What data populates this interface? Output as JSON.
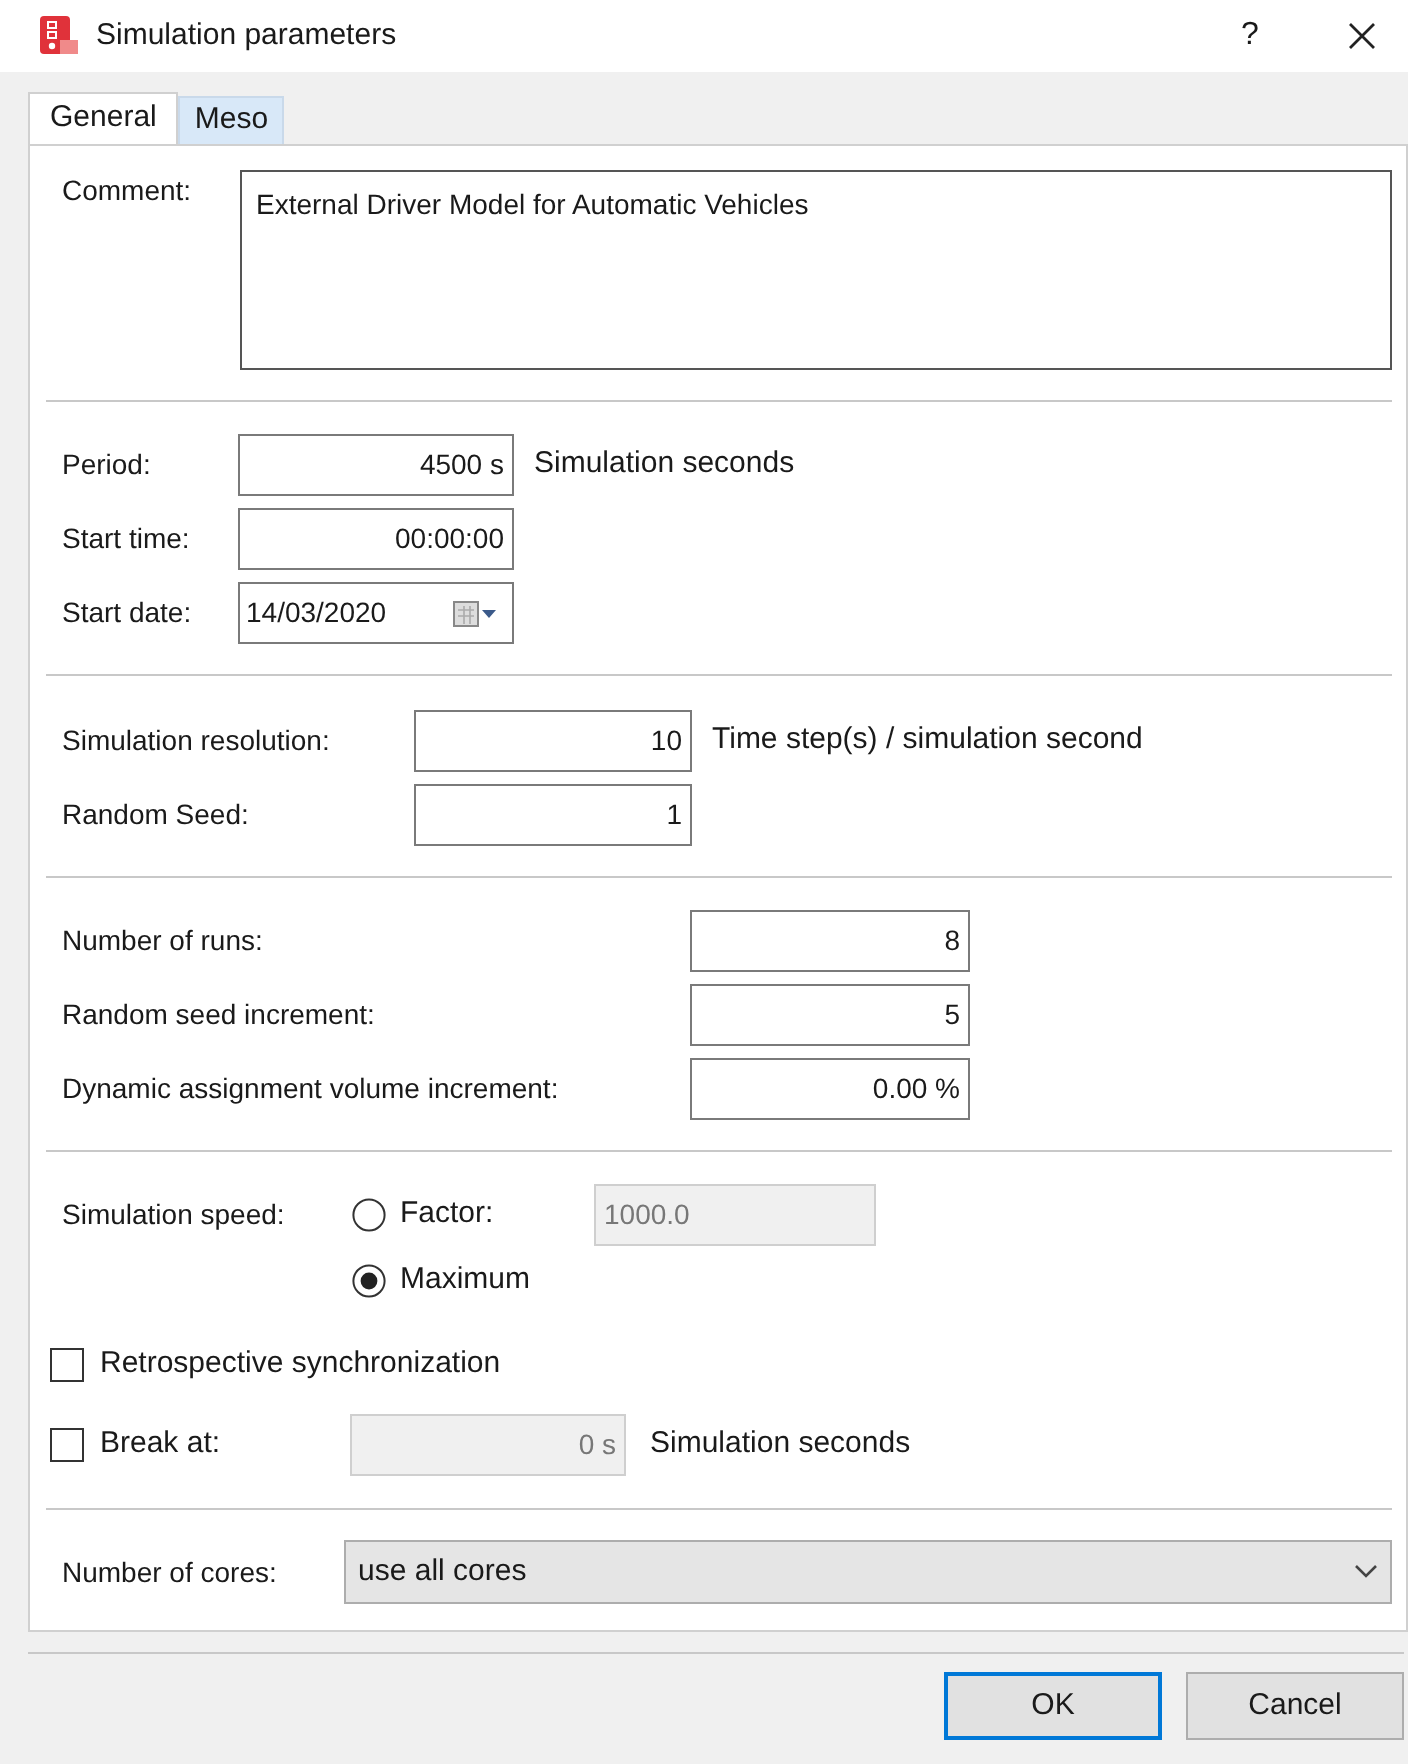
{
  "window": {
    "title": "Simulation parameters",
    "help": "?"
  },
  "tabs": [
    {
      "label": "General",
      "selected": true
    },
    {
      "label": "Meso",
      "selected": false
    }
  ],
  "comment": {
    "label": "Comment:",
    "value": "External Driver Model for Automatic Vehicles"
  },
  "time_section": [
    {
      "label": "Period:",
      "kind": "text",
      "value": "4500 s",
      "suffix": "Simulation seconds"
    },
    {
      "label": "Start time:",
      "kind": "text",
      "value": "00:00:00"
    },
    {
      "label": "Start date:",
      "kind": "date",
      "value": "14/03/2020"
    }
  ],
  "resolution_section": [
    {
      "label": "Simulation resolution:",
      "kind": "text",
      "value": "10",
      "suffix": "Time step(s) / simulation second"
    },
    {
      "label": "Random Seed:",
      "kind": "text",
      "value": "1"
    }
  ],
  "runs_section": [
    {
      "label": "Number of runs:",
      "kind": "text",
      "value": "8"
    },
    {
      "label": "Random seed increment:",
      "kind": "text",
      "value": "5"
    },
    {
      "label": "Dynamic assignment volume increment:",
      "kind": "text",
      "value": "0.00 %"
    }
  ],
  "speed": {
    "label": "Simulation speed:",
    "options": [
      {
        "label": "Factor:",
        "selected": false,
        "value": "1000.0",
        "disabled": true
      },
      {
        "label": "Maximum",
        "selected": true
      }
    ]
  },
  "checks": [
    {
      "label": "Retrospective synchronization",
      "checked": false
    },
    {
      "label": "Break at:",
      "checked": false,
      "value": "0 s",
      "disabled": true,
      "suffix": "Simulation seconds"
    }
  ],
  "cores": {
    "label": "Number of cores:",
    "value": "use all cores"
  },
  "buttons": [
    {
      "label": "OK",
      "kind": "default"
    },
    {
      "label": "Cancel",
      "kind": "normal"
    }
  ]
}
